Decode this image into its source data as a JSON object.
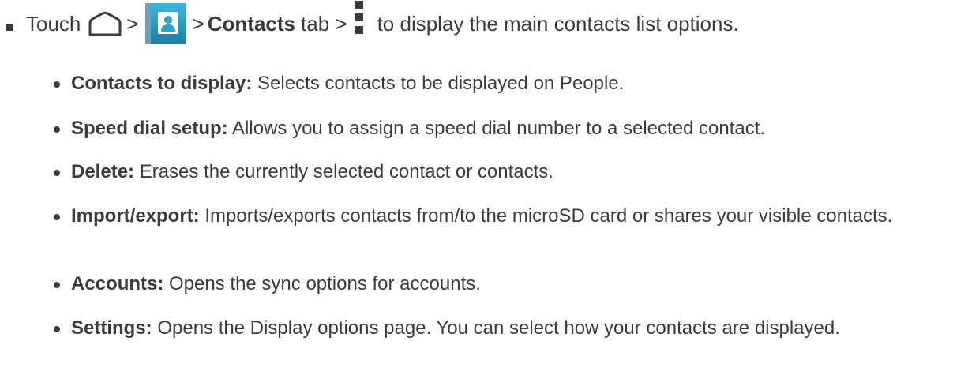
{
  "intro": {
    "prefix": "Touch",
    "sep_1": ">",
    "sep_2": ">",
    "tab_name": "Contacts",
    "tab_suffix": "tab >",
    "suffix": "to display the main contacts list options.",
    "icons": [
      "home-icon",
      "contacts-app-icon",
      "menu-icon"
    ],
    "colors": {
      "contacts_icon_bg": "#2aa3cf",
      "contacts_icon_bg_dark": "#1b7fa8",
      "text": "#3b3b3b"
    }
  },
  "options": [
    {
      "term": "Contacts to display:",
      "description": "Selects contacts to be displayed on People."
    },
    {
      "term": "Speed dial setup:",
      "description": "Allows you to assign a speed dial number to a selected contact."
    },
    {
      "term": "Delete:",
      "description": "Erases the currently selected contact or contacts."
    },
    {
      "term": "Import/export:",
      "description": "Imports/exports contacts from/to the microSD card or shares your visible contacts."
    },
    {
      "term": "Accounts:",
      "description": "Opens the sync options for accounts."
    },
    {
      "term": "Settings:",
      "description": "Opens the Display options page. You can select how your contacts are displayed."
    }
  ]
}
